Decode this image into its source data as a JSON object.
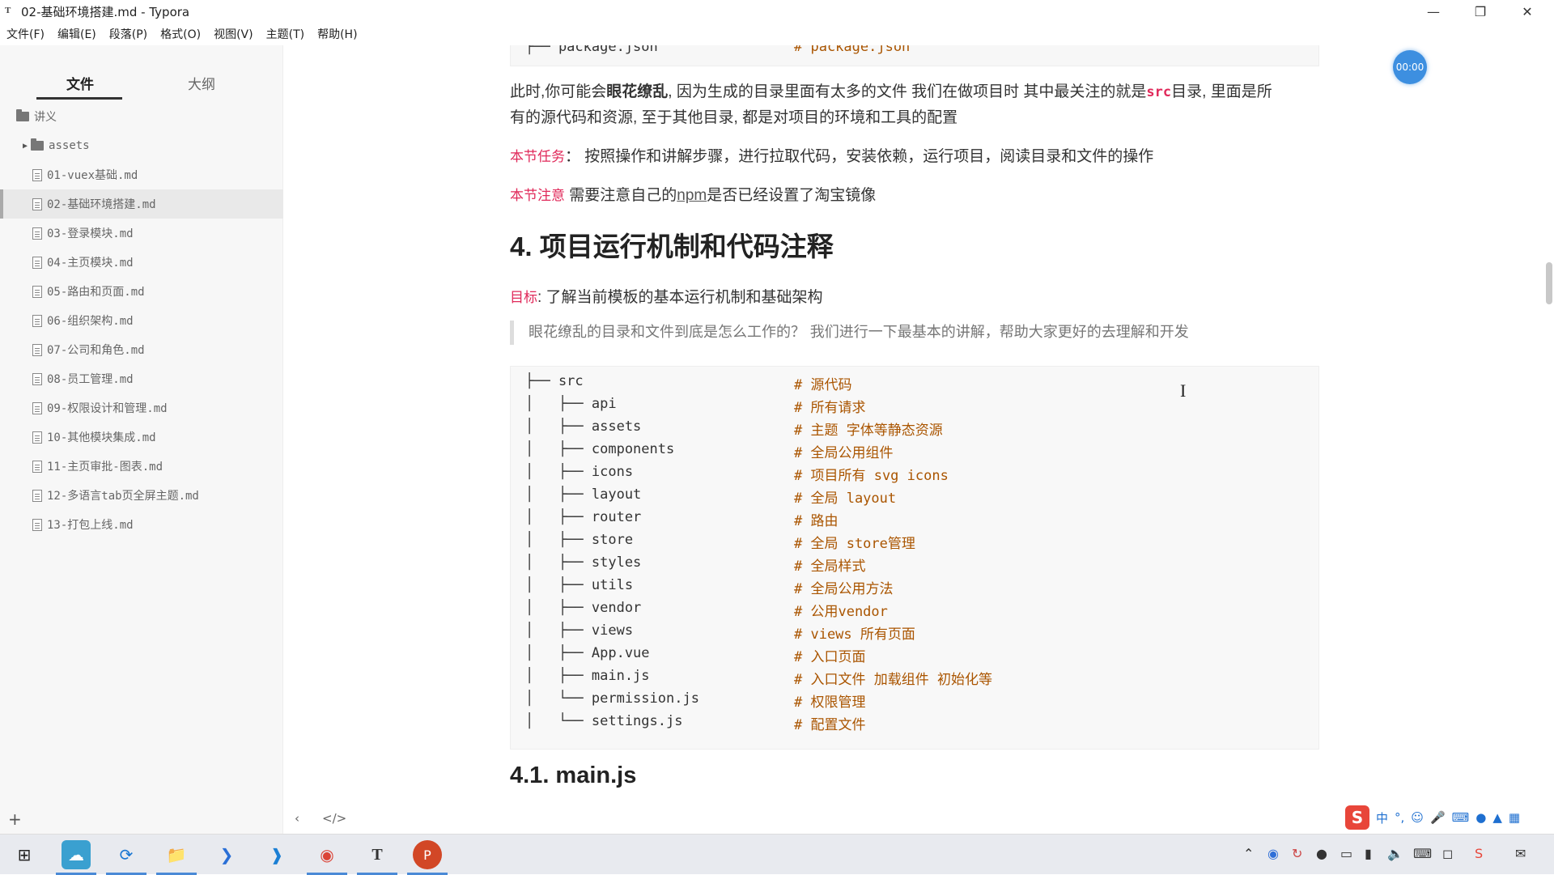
{
  "window": {
    "title": "02-基础环境搭建.md - Typora",
    "app_icon": "T"
  },
  "menu": [
    "文件(F)",
    "编辑(E)",
    "段落(P)",
    "格式(O)",
    "视图(V)",
    "主题(T)",
    "帮助(H)"
  ],
  "sidebar": {
    "tabs": [
      "文件",
      "大纲"
    ],
    "root": "讲义",
    "folder": "assets",
    "files": [
      "01-vuex基础.md",
      "02-基础环境搭建.md",
      "03-登录模块.md",
      "04-主页模块.md",
      "05-路由和页面.md",
      "06-组织架构.md",
      "07-公司和角色.md",
      "08-员工管理.md",
      "09-权限设计和管理.md",
      "10-其他模块集成.md",
      "11-主页审批-图表.md",
      "12-多语言tab页全屏主题.md",
      "13-打包上线.md"
    ],
    "selected_index": 1
  },
  "editor": {
    "top_code_line": {
      "tree": "├── package.json",
      "comment": "# package.json"
    },
    "para1_a": "此时,你可能会",
    "para1_bold": "眼花缭乱",
    "para1_b": ", 因为生成的目录里面有太多的文件 我们在做项目时 其中最关注的就是",
    "para1_code": "src",
    "para1_c": "目录, 里面是所",
    "para1_line2": "有的源代码和资源, 至于其他目录, 都是对项目的环境和工具的配置",
    "task_tag": "本节任务",
    "task_text": "：   按照操作和讲解步骤，进行拉取代码，安装依赖，运行项目，阅读目录和文件的操作",
    "note_tag": "本节注意",
    "note_a": " 需要注意自己的",
    "note_link": "npm",
    "note_b": "是否已经设置了淘宝镜像",
    "heading": "4. 项目运行机制和代码注释",
    "goal_tag": "目标",
    "goal_text": ": 了解当前模板的基本运行机制和基础架构",
    "quote": "眼花缭乱的目录和文件到底是怎么工作的？  我们进行一下最基本的讲解，帮助大家更好的去理解和开发",
    "code_lines": [
      {
        "tree": "├── src",
        "comment": "# 源代码"
      },
      {
        "tree": "│   ├── api",
        "comment": "# 所有请求"
      },
      {
        "tree": "│   ├── assets",
        "comment": "# 主题 字体等静态资源"
      },
      {
        "tree": "│   ├── components",
        "comment": "# 全局公用组件"
      },
      {
        "tree": "│   ├── icons",
        "comment": "# 项目所有 svg icons"
      },
      {
        "tree": "│   ├── layout",
        "comment": "# 全局 layout"
      },
      {
        "tree": "│   ├── router",
        "comment": "# 路由"
      },
      {
        "tree": "│   ├── store",
        "comment": "# 全局 store管理"
      },
      {
        "tree": "│   ├── styles",
        "comment": "# 全局样式"
      },
      {
        "tree": "│   ├── utils",
        "comment": "# 全局公用方法"
      },
      {
        "tree": "│   ├── vendor",
        "comment": "# 公用vendor"
      },
      {
        "tree": "│   ├── views",
        "comment": "# views 所有页面"
      },
      {
        "tree": "│   ├── App.vue",
        "comment": "# 入口页面"
      },
      {
        "tree": "│   ├── main.js",
        "comment": "# 入口文件 加载组件 初始化等"
      },
      {
        "tree": "│   └── permission.js",
        "comment": "# 权限管理"
      },
      {
        "tree": "│   └── settings.js",
        "comment": "# 配置文件"
      }
    ],
    "subheading": "4.1. main.js"
  },
  "timer": "00:00",
  "ime": {
    "logo": "S",
    "lang": "中"
  },
  "colors": {
    "accent": "#e0295a",
    "comment": "#aa5500",
    "timer": "#3d8fe0"
  }
}
